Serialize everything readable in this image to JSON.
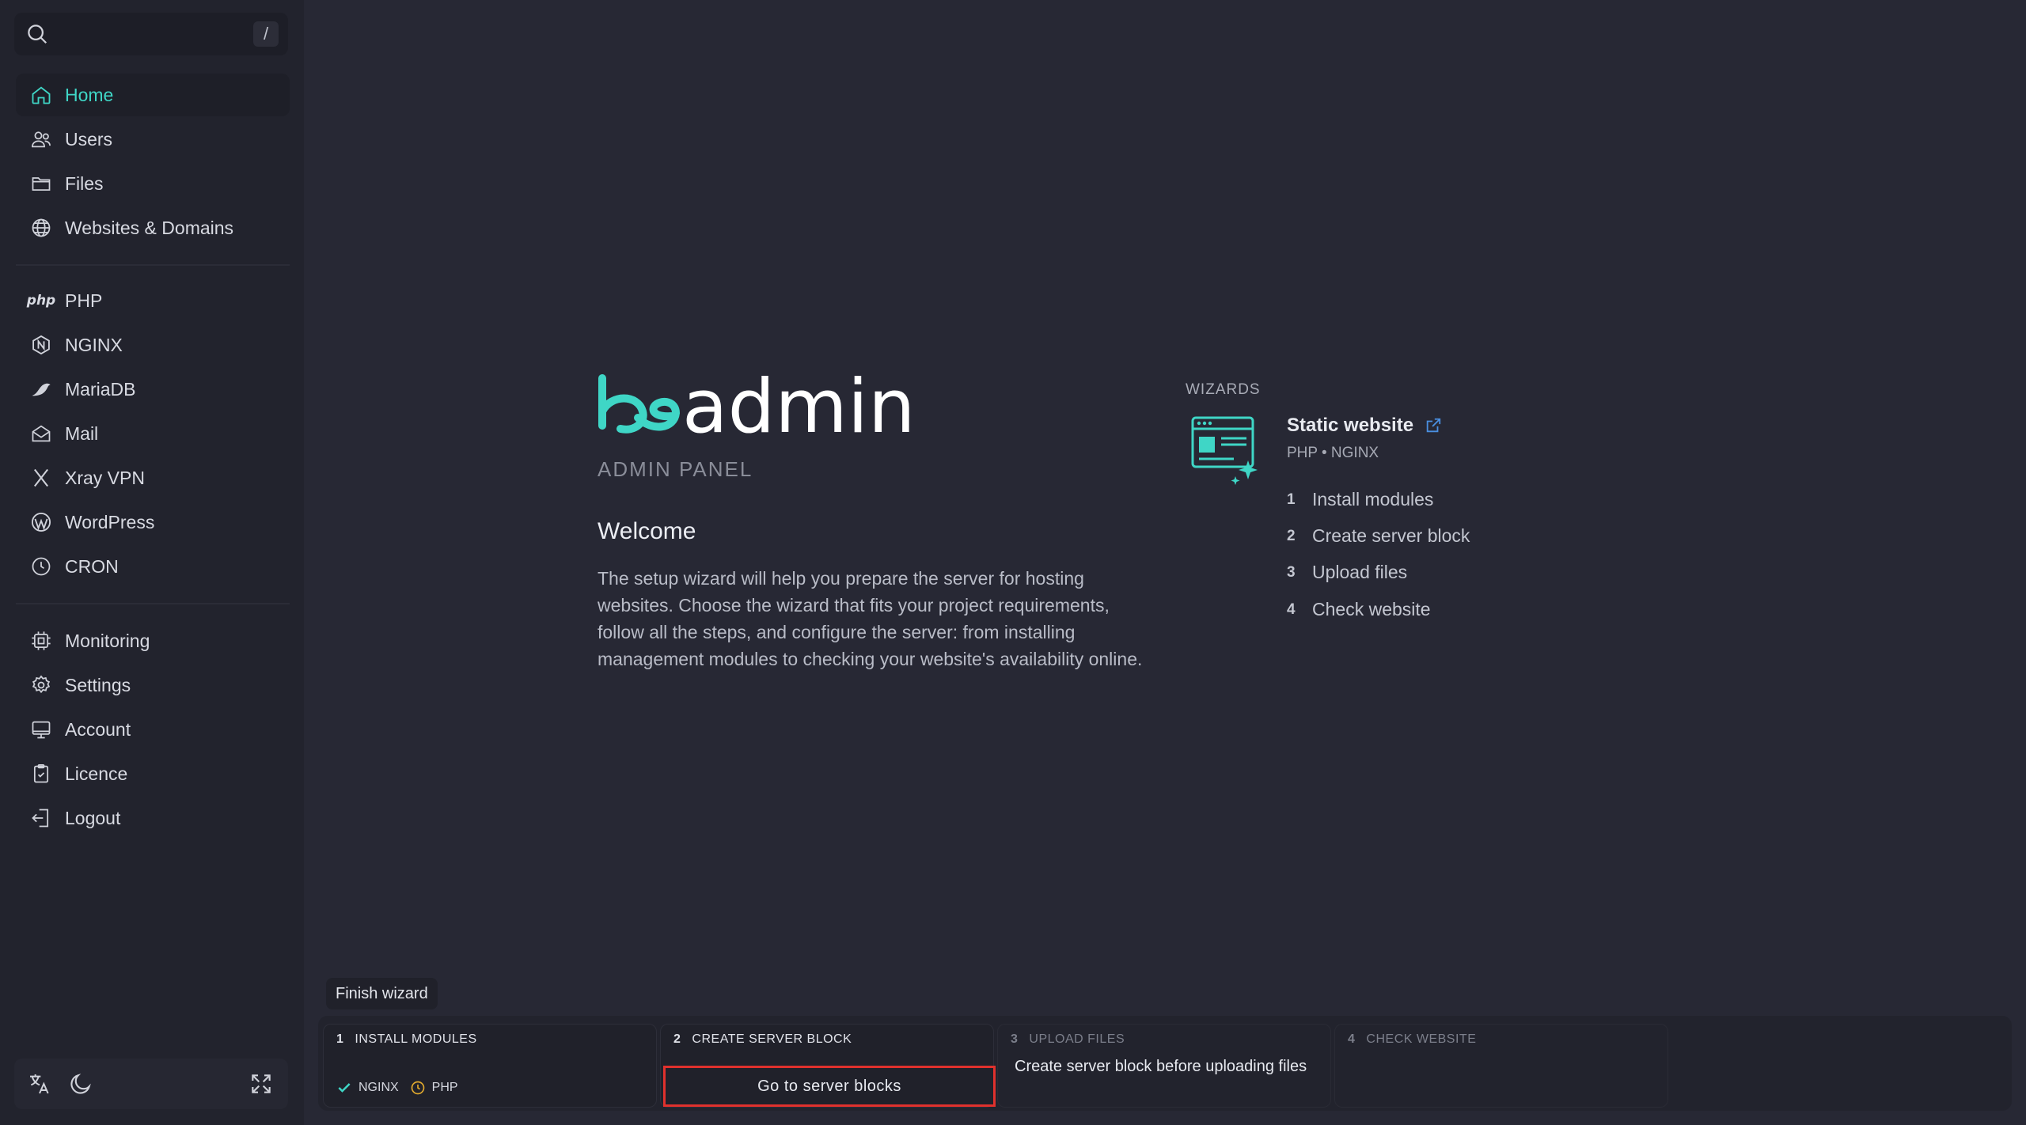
{
  "search": {
    "shortcut": "/"
  },
  "sidebar": {
    "group1": [
      {
        "label": "Home",
        "icon": "home-icon",
        "active": true
      },
      {
        "label": "Users",
        "icon": "users-icon"
      },
      {
        "label": "Files",
        "icon": "folder-icon"
      },
      {
        "label": "Websites & Domains",
        "icon": "globe-icon"
      }
    ],
    "group2": [
      {
        "label": "PHP",
        "icon": "php-icon",
        "icon_text": "php"
      },
      {
        "label": "NGINX",
        "icon": "nginx-icon"
      },
      {
        "label": "MariaDB",
        "icon": "mariadb-icon"
      },
      {
        "label": "Mail",
        "icon": "mail-icon"
      },
      {
        "label": "Xray VPN",
        "icon": "xray-icon"
      },
      {
        "label": "WordPress",
        "icon": "wordpress-icon"
      },
      {
        "label": "CRON",
        "icon": "clock-icon"
      }
    ],
    "group3": [
      {
        "label": "Monitoring",
        "icon": "cpu-icon"
      },
      {
        "label": "Settings",
        "icon": "gear-icon"
      },
      {
        "label": "Account",
        "icon": "monitor-icon"
      },
      {
        "label": "Licence",
        "icon": "licence-icon"
      },
      {
        "label": "Logout",
        "icon": "logout-icon"
      }
    ]
  },
  "logo": {
    "text": "admin"
  },
  "main": {
    "subtitle": "ADMIN PANEL",
    "welcome": "Welcome",
    "description": "The setup wizard will help you prepare the server for hosting websites. Choose the wizard that fits your project requirements, follow all the steps, and configure the server: from installing management modules to checking your website's availability online."
  },
  "wizards": {
    "label": "WIZARDS",
    "title": "Static website",
    "sub": "PHP • NGINX",
    "steps": [
      {
        "n": "1",
        "label": "Install modules"
      },
      {
        "n": "2",
        "label": "Create server block"
      },
      {
        "n": "3",
        "label": "Upload files"
      },
      {
        "n": "4",
        "label": "Check website"
      }
    ]
  },
  "bottom": {
    "finish": "Finish wizard",
    "cards": [
      {
        "n": "1",
        "title": "INSTALL MODULES"
      },
      {
        "n": "2",
        "title": "CREATE SERVER BLOCK"
      },
      {
        "n": "3",
        "title": "UPLOAD FILES"
      },
      {
        "n": "4",
        "title": "CHECK WEBSITE"
      }
    ],
    "modules": [
      {
        "label": "NGINX",
        "status": "done"
      },
      {
        "label": "PHP",
        "status": "pending"
      }
    ],
    "go_button": "Go to server blocks",
    "card3_text": "Create server block before uploading files"
  },
  "colors": {
    "accent": "#3fd6c6",
    "highlight_border": "#e0312d",
    "background": "#272834",
    "sidebar": "#22232d"
  }
}
